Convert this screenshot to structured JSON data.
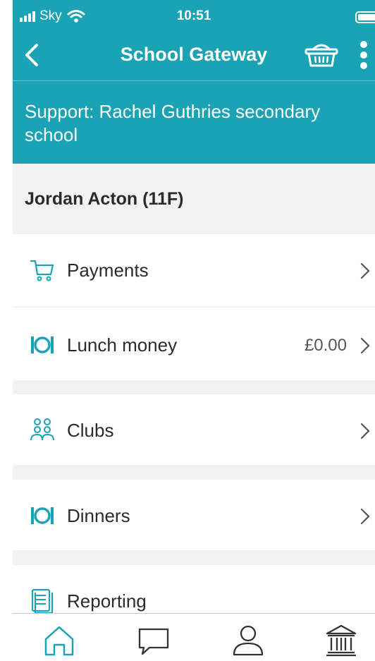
{
  "status_bar": {
    "carrier": "Sky",
    "time": "10:51"
  },
  "nav": {
    "title": "School Gateway",
    "back_icon": "chevron-left-icon",
    "basket_icon": "basket-icon",
    "more_icon": "more-vertical-icon"
  },
  "support": {
    "text": "Support: Rachel Guthries secondary school"
  },
  "student": {
    "name": "Jordan Acton (11F)"
  },
  "menu": [
    {
      "label": "Payments",
      "icon": "cart-icon",
      "value": ""
    },
    {
      "label": "Lunch money",
      "icon": "cutlery-icon",
      "value": "£0.00"
    },
    {
      "label": "Clubs",
      "icon": "group-icon",
      "value": ""
    },
    {
      "label": "Dinners",
      "icon": "cutlery-icon",
      "value": ""
    },
    {
      "label": "Reporting",
      "icon": "document-icon",
      "value": ""
    }
  ],
  "tabs": [
    {
      "icon": "home-icon"
    },
    {
      "icon": "chat-icon"
    },
    {
      "icon": "user-icon"
    },
    {
      "icon": "bank-icon"
    }
  ],
  "colors": {
    "primary": "#1aa3b5",
    "section_bg": "#f2f2f2",
    "text": "#2b2b2b"
  }
}
